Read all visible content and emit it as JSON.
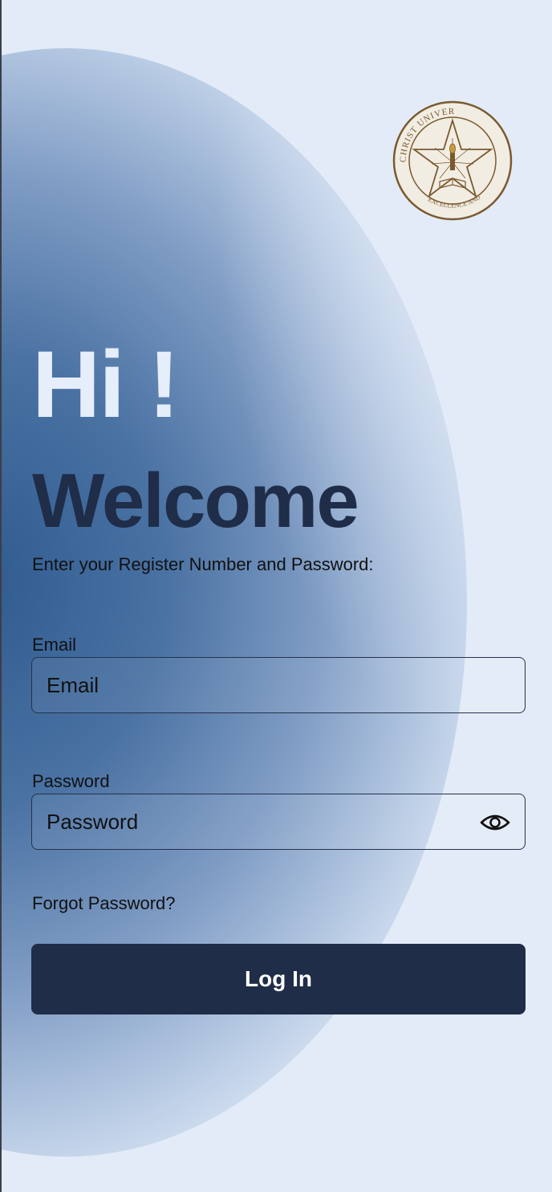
{
  "logo": {
    "name": "christ-university-seal",
    "text_top": "CHRIST UNIVERSITY",
    "text_bottom": "EXCELLENCE AND SERVICE",
    "color": "#7a5a2e"
  },
  "greeting": {
    "hi": "Hi !",
    "welcome": "Welcome",
    "instruction": "Enter your Register Number and Password:"
  },
  "form": {
    "email_label": "Email",
    "email_placeholder": "Email",
    "password_label": "Password",
    "password_placeholder": "Password",
    "show_password_icon": "eye-icon",
    "forgot_password": "Forgot Password?",
    "login_label": "Log In"
  },
  "colors": {
    "primary": "#202d48",
    "background": "#e3ebf8",
    "accent_blob": "#2f5a8f"
  }
}
